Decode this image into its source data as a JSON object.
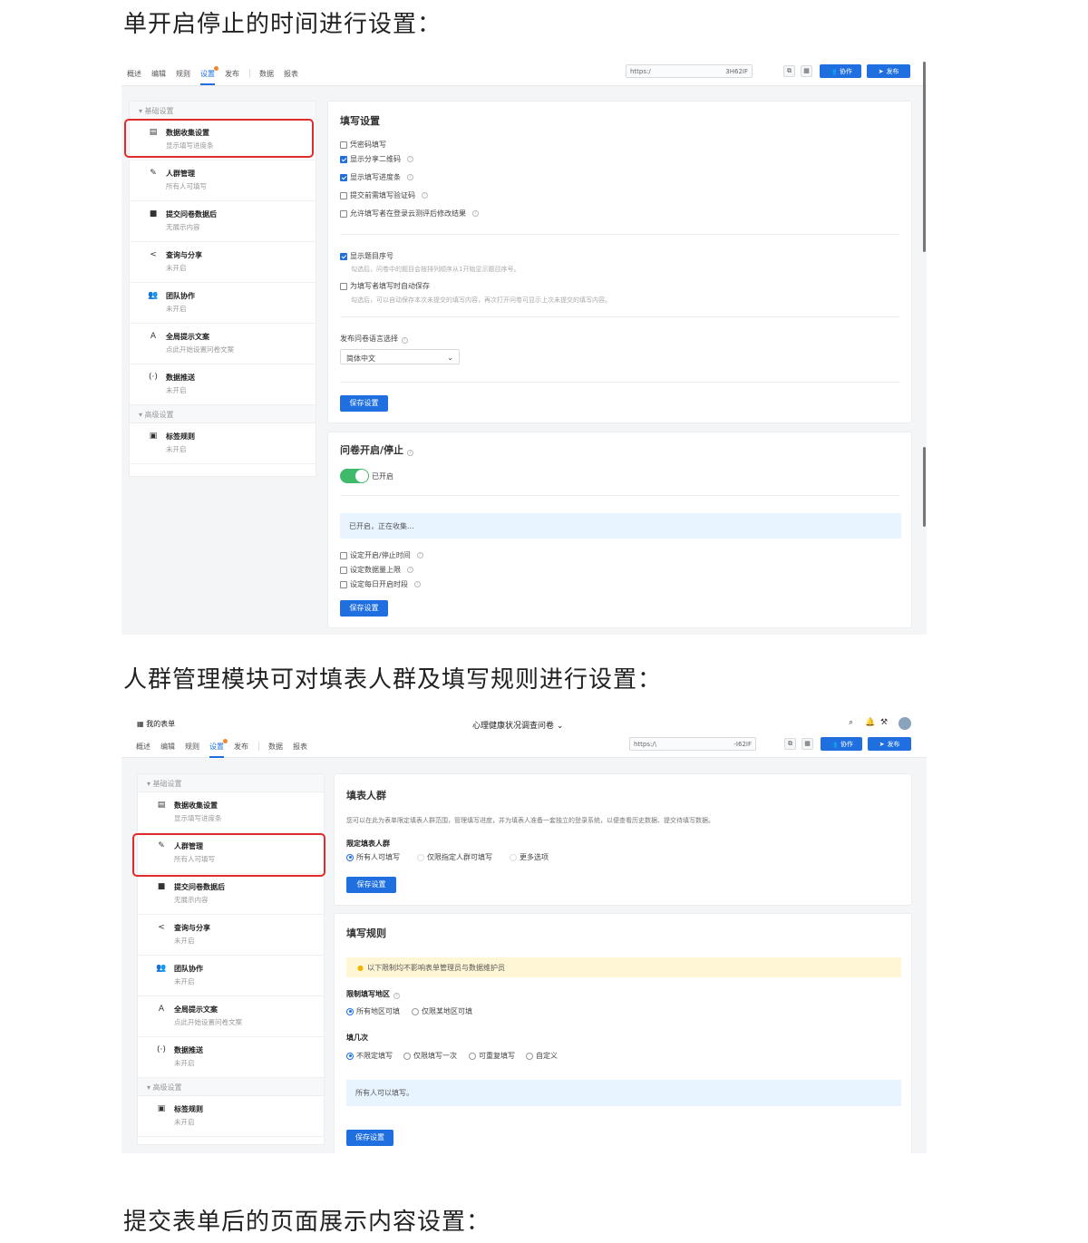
{
  "headings": {
    "h1": "单开启停止的时间进行设置：",
    "h2": "人群管理模块可对填表人群及填写规则进行设置：",
    "h3": "提交表单后的页面展示内容设置："
  },
  "tabs": [
    "概述",
    "编辑",
    "规则",
    "设置",
    "发布",
    "数据",
    "报表"
  ],
  "url": {
    "start": "https:/",
    "end1": "3H62IF",
    "start2": "https:/\\",
    "end2": "-I62IF"
  },
  "buttons": {
    "collab": "协作",
    "publish": "发布",
    "save": "保存设置"
  },
  "header2": {
    "my_forms": "我的表单",
    "form_title": "心理健康状况调查问卷"
  },
  "sidebar": {
    "group_basic": "▾ 基础设置",
    "group_adv": "▾ 高级设置",
    "items": [
      {
        "icon": "▤",
        "title": "数据收集设置",
        "sub": "显示填写进度条"
      },
      {
        "icon": "✎",
        "title": "人群管理",
        "sub": "所有人可填写"
      },
      {
        "icon": "■",
        "title": "提交问卷数据后",
        "sub": "无展示内容"
      },
      {
        "icon": "<",
        "title": "查询与分享",
        "sub": "未开启"
      },
      {
        "icon": "👥",
        "title": "团队协作",
        "sub": "未开启"
      },
      {
        "icon": "A",
        "title": "全局提示文案",
        "sub": "点此开始设置问卷文案"
      },
      {
        "icon": "(·)",
        "title": "数据推送",
        "sub": "未开启"
      }
    ],
    "adv_item": {
      "icon": "▣",
      "title": "标签规则",
      "sub": "未开启"
    }
  },
  "fill_settings": {
    "title": "填写设置",
    "opts": [
      {
        "label": "凭密码填写",
        "checked": false
      },
      {
        "label": "显示分享二维码",
        "checked": true
      },
      {
        "label": "显示填写进度条",
        "checked": true
      },
      {
        "label": "提交前需填写验证码",
        "checked": false
      },
      {
        "label": "允许填写者在登录云测评后修改结果",
        "checked": false
      }
    ],
    "show_no": "显示题目序号",
    "show_no_hint": "勾选后，问卷中的题目会按排列顺序从1开始显示题目序号。",
    "autosave": "为填写者填写时自动保存",
    "autosave_hint": "勾选后，可以自动保存本次未提交的填写内容，再次打开问卷可显示上次未提交的填写内容。",
    "lang_label": "发布问卷语言选择",
    "lang_value": "简体中文"
  },
  "start_stop": {
    "title": "问卷开启/停止",
    "toggle_label": "已开启",
    "status": "已开启，正在收集...",
    "opts": [
      "设定开启/停止时间",
      "设定数据量上限",
      "设定每日开启时段"
    ]
  },
  "crowd": {
    "title": "填表人群",
    "desc": "您可以在此为表单限定填表人群范围，管理填写进度，并为填表人准备一套独立的登录系统，以便查看历史数据、提交待填写数据。",
    "limit_label": "限定填表人群",
    "opts": [
      "所有人可填写",
      "仅限指定人群可填写",
      "更多选项"
    ]
  },
  "rules": {
    "title": "填写规则",
    "warn": "以下限制均不影响表单管理员与数据维护员",
    "region_label": "限制填写地区",
    "region_opts": [
      "所有地区可填",
      "仅限某地区可填"
    ],
    "times_label": "填几次",
    "times_opts": [
      "不限定填写",
      "仅限填写一次",
      "可重复填写",
      "自定义"
    ],
    "info": "所有人可以填写。"
  },
  "colors": {
    "accent": "#1f6fe0",
    "highlight": "#e12b2b",
    "toggle_on": "#3fb96a"
  }
}
